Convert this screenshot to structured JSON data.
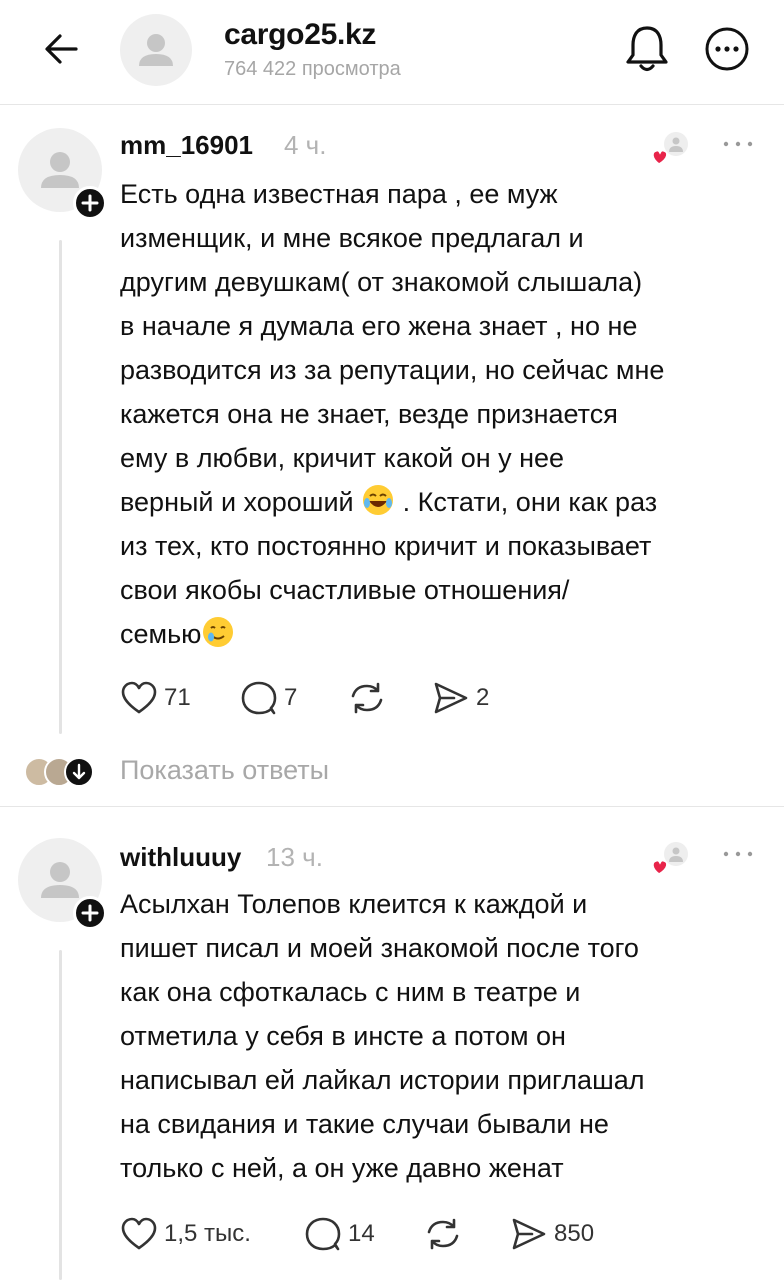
{
  "header": {
    "title": "cargo25.kz",
    "subtitle": "764 422 просмотра"
  },
  "comments": [
    {
      "username": "mm_16901",
      "time": "4 ч.",
      "text_part1": "Есть одна известная пара , ее муж\nизменщик, и мне всякое предлагал и\nдругим девушкам( от знакомой слышала)\nв начале я думала его жена знает , но не\nразводится из за репутации, но сейчас мне\nкажется она не знает, везде признается\nему в любви, кричит какой он у нее\nверный и хороший ",
      "text_part2": " . Кстати, они как раз\nиз тех, кто постоянно кричит и показывает\nсвои якобы счастливые отношения/\nсемью",
      "likes": "71",
      "replies": "7",
      "shares": "2",
      "show_replies": "Показать ответы"
    },
    {
      "username": "withluuuy",
      "time": "13 ч.",
      "text": "Асылхан Толепов клеится к каждой и\nпишет писал и моей знакомой после того\nкак она сфоткалась с ним в театре и\nотметила у себя в инсте а потом он\nнаписывал ей лайкал истории приглашал\nна свидания и такие случаи бывали не\nтолько с ней, а он уже давно женат",
      "likes": "1,5 тыс.",
      "replies": "14",
      "shares": "850"
    }
  ],
  "icons": {
    "back": "arrow-left-icon",
    "bell": "bell-icon",
    "more": "more-circle-icon",
    "like": "heart-outline-icon",
    "comment": "comment-bubble-icon",
    "repost": "repost-icon",
    "share": "send-icon"
  },
  "colors": {
    "heart": "#e8244a",
    "muted": "#a6a6a6"
  }
}
